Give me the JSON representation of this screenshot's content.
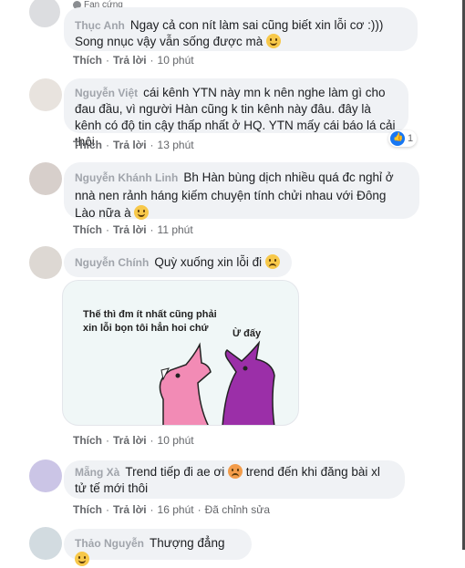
{
  "comments": [
    {
      "badge": "Fan cứng",
      "name": "Thục Anh",
      "text": "Ngay cả con nít làm sai cũng biết xin lỗi cơ :)))",
      "text2": "Song nnục vậy vẫn sống được mà",
      "like": "Thích",
      "reply": "Trả lời",
      "time": "10 phút"
    },
    {
      "name": "Nguyễn Việt",
      "text": "cái kênh YTN này mn k nên nghe làm gì cho đau đầu, vì người Hàn cũng k tin kênh này đâu. đây là kênh có độ tin cậy thấp nhất ở HQ. YTN mấy cái báo lá cải thôi",
      "like": "Thích",
      "reply": "Trả lời",
      "time": "13 phút",
      "reaction_count": "1"
    },
    {
      "name": "Nguyễn Khánh Linh",
      "text": "Bh Hàn bùng dịch nhiều quá đc nghỉ ở nnà nen rảnh háng kiếm chuyện tính chửi nhau với Đông Lào nữa à",
      "like": "Thích",
      "reply": "Trả lời",
      "time": "11 phút"
    },
    {
      "name": "Nguyễn Chính",
      "text": "Quỳ xuống xin lỗi đi",
      "like": "Thích",
      "reply": "Trả lời",
      "time": "10 phút",
      "sticker_text1": "Thế thì đm ít nhất cũng phải xin lỗi bọn tôi hẳn hoi chứ",
      "sticker_text2": "Ừ đấy"
    },
    {
      "name": "Mẵng Xà",
      "text": "Trend tiếp đi ae ơi",
      "text2": "trend đến khi đăng bài xl tử tế mới thôi",
      "like": "Thích",
      "reply": "Trả lời",
      "time": "16 phút",
      "edited": "Đã chỉnh sửa"
    },
    {
      "name": "Thảo Nguyễn",
      "text": "Thượng đẳng"
    }
  ],
  "colors": {
    "bubble": "#f0f2f5",
    "meta": "#65676b",
    "like_blue": "#1877f2",
    "dragon_pink": "#f28bb5",
    "dragon_purple": "#9b2fa8"
  }
}
